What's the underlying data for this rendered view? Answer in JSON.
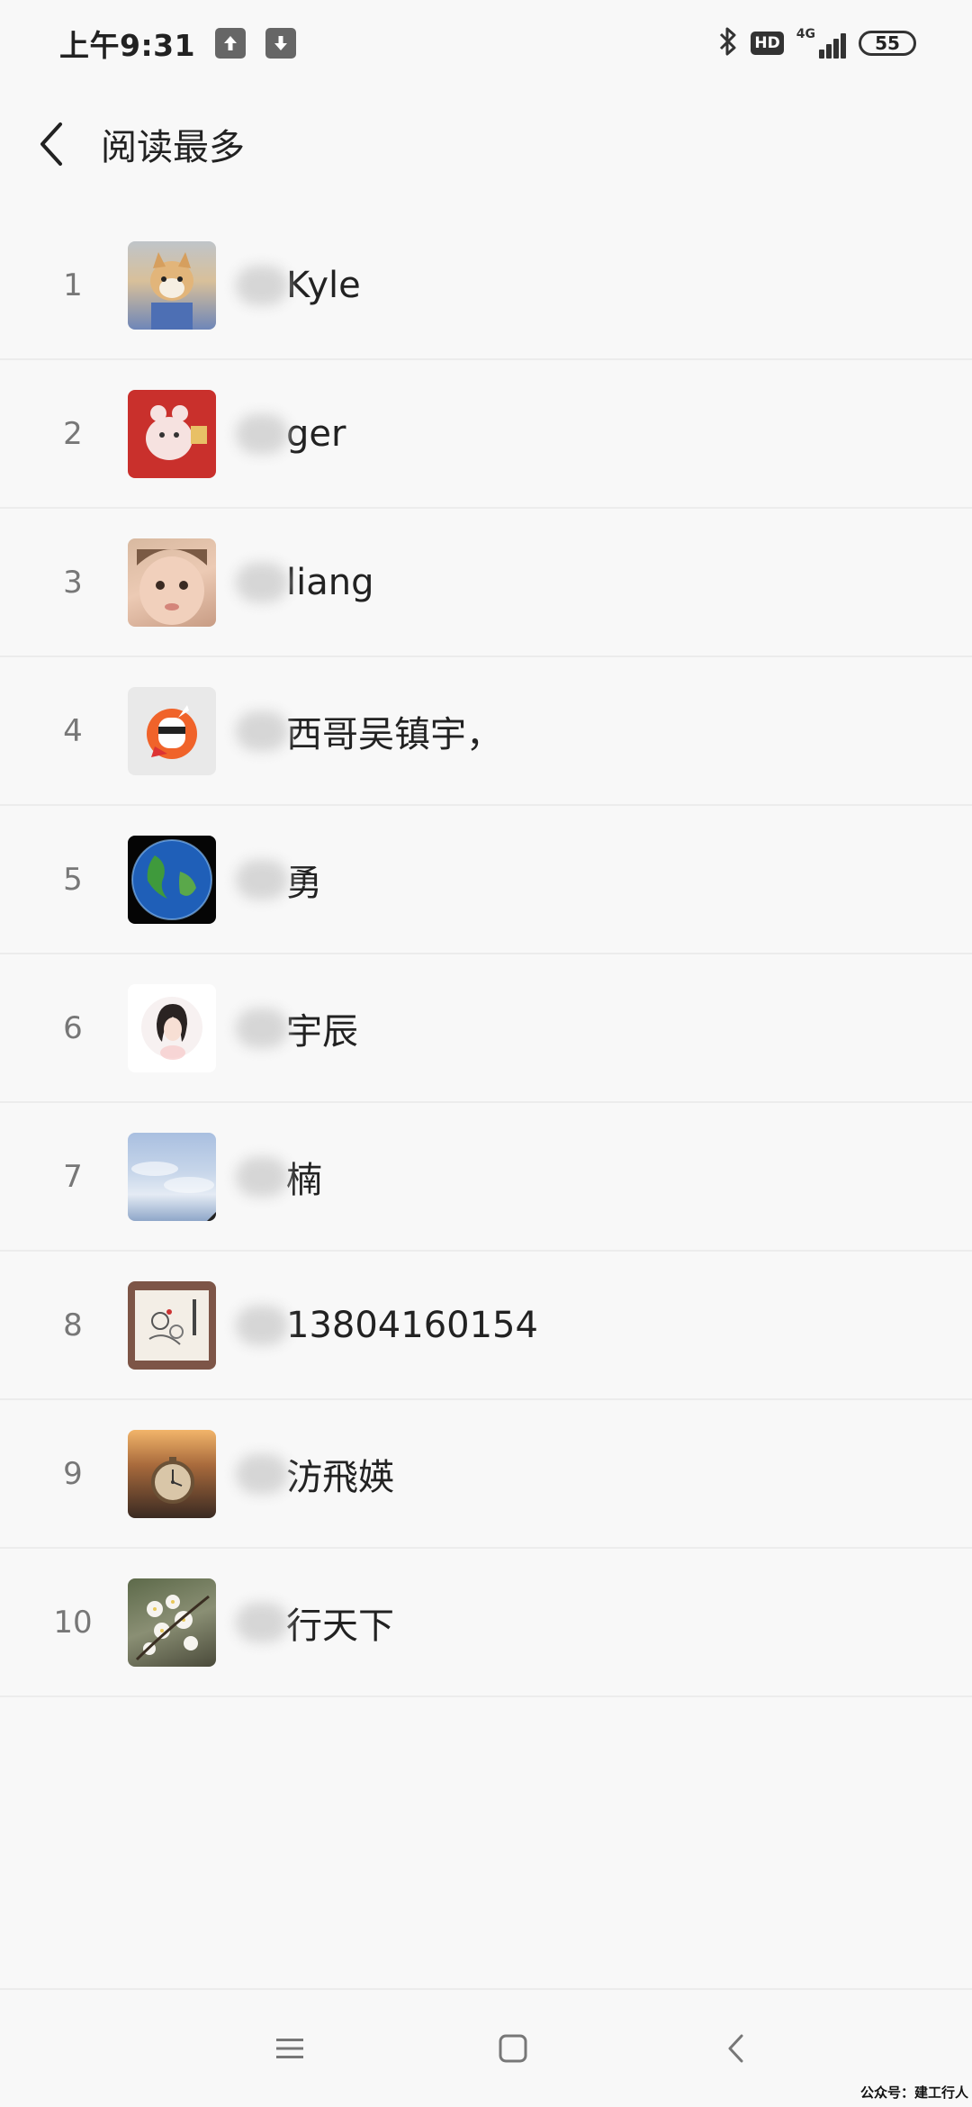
{
  "status_bar": {
    "time": "上午9:31",
    "hd_badge": "HD",
    "network": "4G",
    "battery": "55"
  },
  "header": {
    "title": "阅读最多"
  },
  "readers": [
    {
      "rank": "1",
      "name": "Kyle"
    },
    {
      "rank": "2",
      "name": "ger"
    },
    {
      "rank": "3",
      "name": "liang"
    },
    {
      "rank": "4",
      "name": "西哥吴镇宇，"
    },
    {
      "rank": "5",
      "name": "勇"
    },
    {
      "rank": "6",
      "name": "宇辰"
    },
    {
      "rank": "7",
      "name": "楠"
    },
    {
      "rank": "8",
      "name": "13804160154"
    },
    {
      "rank": "9",
      "name": "汸飛媖"
    },
    {
      "rank": "10",
      "name": "行天下"
    }
  ],
  "watermark": "公众号：建工行人",
  "icons": {
    "upload": "upload-arrow-icon",
    "download": "download-arrow-icon",
    "bluetooth": "bluetooth-icon",
    "back": "chevron-left-icon",
    "menu": "hamburger-icon",
    "home": "square-home-icon",
    "nav_back": "chevron-left-icon"
  }
}
